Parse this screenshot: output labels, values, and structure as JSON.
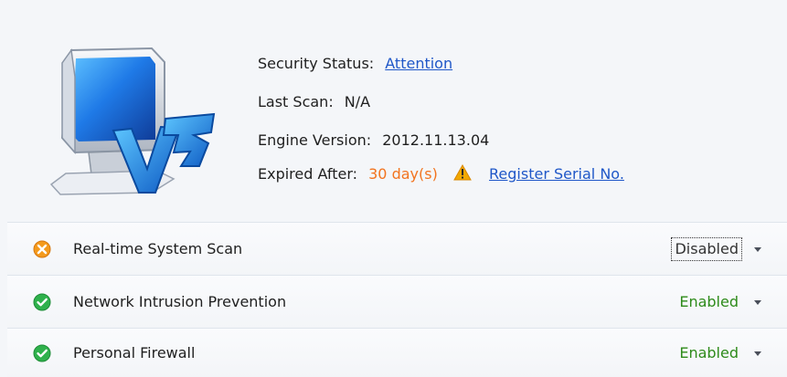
{
  "status": {
    "security_status_label": "Security Status:",
    "security_status_value": "Attention",
    "last_scan_label": "Last Scan:",
    "last_scan_value": "N/A",
    "engine_version_label": "Engine Version:",
    "engine_version_value": "2012.11.13.04",
    "expired_after_label": "Expired After:",
    "expired_after_value": "30 day(s)",
    "register_link": "Register Serial No."
  },
  "protections": [
    {
      "label": "Real-time System Scan",
      "state": "Disabled",
      "icon": "warning-x-icon",
      "state_color": "#333333"
    },
    {
      "label": "Network Intrusion Prevention",
      "state": "Enabled",
      "icon": "check-icon",
      "state_color": "#2e8b1a"
    },
    {
      "label": "Personal Firewall",
      "state": "Enabled",
      "icon": "check-icon",
      "state_color": "#2e8b1a"
    }
  ],
  "colors": {
    "link": "#1f57c8",
    "warning_orange": "#f2741f",
    "enabled_green": "#2e8b1a"
  }
}
